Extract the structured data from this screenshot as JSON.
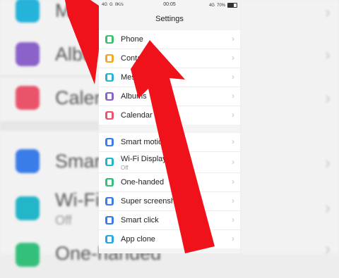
{
  "statusbar": {
    "signal_left": "4G",
    "signal_mid": "G",
    "speed": "0K/s",
    "time": "00:05",
    "net_right": "4G",
    "battery": "70%"
  },
  "header": {
    "title": "Settings"
  },
  "groups": [
    {
      "items": [
        {
          "label": "Phone",
          "icon": "phone-icon",
          "color": "#3cc06a"
        },
        {
          "label": "Contacts",
          "icon": "contacts-icon",
          "color": "#f5a623"
        },
        {
          "label": "Messages",
          "icon": "messages-icon",
          "color": "#25b3d9"
        },
        {
          "label": "Albums",
          "icon": "albums-icon",
          "color": "#8a62c9"
        },
        {
          "label": "Calendar",
          "icon": "calendar-icon",
          "color": "#e9546b"
        }
      ]
    },
    {
      "items": [
        {
          "label": "Smart motion",
          "icon": "smart-motion-icon",
          "color": "#3a7de8"
        },
        {
          "label": "Wi-Fi Display",
          "sub": "Off",
          "icon": "wifi-display-icon",
          "color": "#22b6c8"
        },
        {
          "label": "One-handed",
          "icon": "one-handed-icon",
          "color": "#34c07a"
        },
        {
          "label": "Super screenshot",
          "icon": "super-screenshot-icon",
          "color": "#3a7de8"
        },
        {
          "label": "Smart click",
          "icon": "smart-click-icon",
          "color": "#3a7de8"
        },
        {
          "label": "App clone",
          "icon": "app-clone-icon",
          "color": "#25a9e0"
        }
      ]
    }
  ],
  "background": {
    "left_items": [
      {
        "label": "Messages",
        "color": "#25b3d9"
      },
      {
        "label": "Albums",
        "color": "#8a62c9"
      },
      {
        "label": "Calendar",
        "color": "#e9546b"
      },
      {
        "label": "Smart motion",
        "color": "#3a7de8"
      },
      {
        "label": "Wi-Fi Display",
        "sub": "Off",
        "color": "#22b6c8"
      },
      {
        "label": "One-handed",
        "color": "#34c07a"
      }
    ]
  },
  "chevron": "›",
  "colors": {
    "arrow": "#f0121b"
  }
}
